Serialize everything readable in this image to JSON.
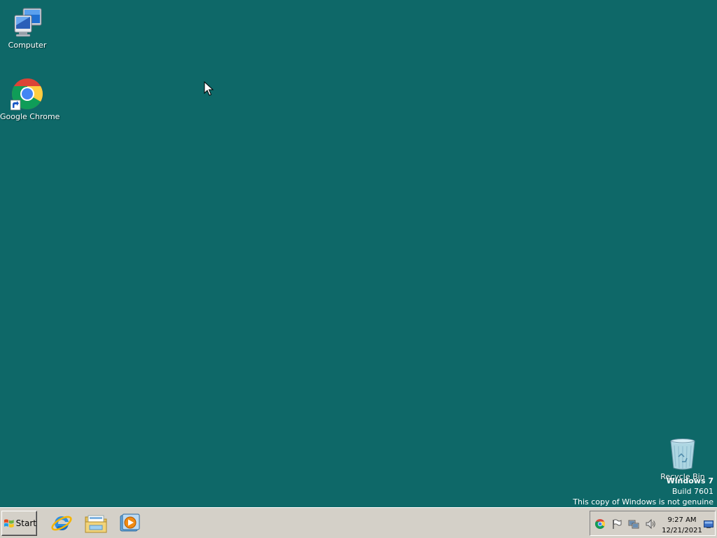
{
  "desktop": {
    "background_color": "#0e6868",
    "icons": [
      {
        "label": "Computer",
        "icon": "computer-icon"
      },
      {
        "label": "Google Chrome",
        "icon": "chrome-icon"
      },
      {
        "label": "Recycle Bin",
        "icon": "recycle-bin-icon"
      }
    ]
  },
  "watermark": {
    "title": "Windows 7",
    "build": "Build 7601",
    "notice": "This copy of Windows is not genuine"
  },
  "taskbar": {
    "start_label": "Start",
    "pinned": [
      {
        "icon": "internet-explorer-icon"
      },
      {
        "icon": "windows-explorer-icon"
      },
      {
        "icon": "media-player-icon"
      }
    ],
    "tray": {
      "icons": [
        "chrome-tray-icon",
        "action-center-flag-icon",
        "network-icon",
        "volume-icon"
      ],
      "time": "9:27 AM",
      "date": "12/21/2021"
    }
  }
}
